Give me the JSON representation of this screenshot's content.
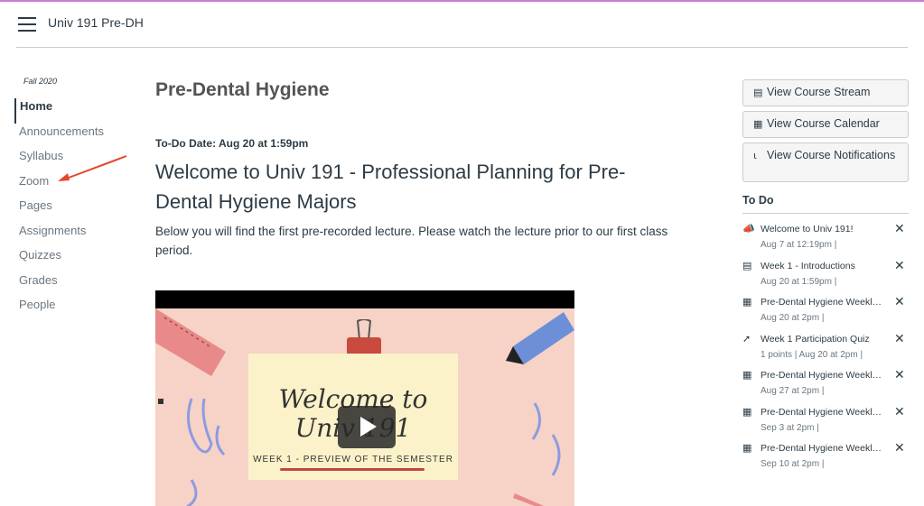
{
  "header": {
    "course_title": "Univ 191 Pre-DH"
  },
  "nav": {
    "term": "Fall 2020",
    "items": [
      {
        "label": "Home"
      },
      {
        "label": "Announcements"
      },
      {
        "label": "Syllabus"
      },
      {
        "label": "Zoom"
      },
      {
        "label": "Pages"
      },
      {
        "label": "Assignments"
      },
      {
        "label": "Quizzes"
      },
      {
        "label": "Grades"
      },
      {
        "label": "People"
      }
    ]
  },
  "main": {
    "page_title": "Pre-Dental Hygiene",
    "todo_date": "To-Do Date: Aug 20 at 1:59pm",
    "welcome": "Welcome to Univ 191 - Professional Planning for Pre-Dental Hygiene Majors",
    "description": "Below you will find the first pre-recorded lecture. Please watch the lecture prior to our first class period.",
    "video": {
      "title": "Welcome to Univ 191",
      "subtitle": "WEEK 1 - PREVIEW OF THE SEMESTER"
    }
  },
  "sidebar": {
    "buttons": [
      {
        "label": "View Course Stream",
        "icon": "stream-icon"
      },
      {
        "label": "View Course Calendar",
        "icon": "calendar-icon"
      },
      {
        "label": "View Course Notifications",
        "icon": "bell-icon"
      }
    ],
    "todo_heading": "To Do",
    "todo": [
      {
        "title": "Welcome to Univ 191!",
        "meta": "Aug 7 at 12:19pm  |",
        "icon": "announcement-icon"
      },
      {
        "title": "Week 1 - Introductions",
        "meta": "Aug 20 at 1:59pm  |",
        "icon": "page-icon"
      },
      {
        "title": "Pre-Dental Hygiene Weekly Reflection",
        "meta": "Aug 20 at 2pm  |",
        "icon": "assignment-icon"
      },
      {
        "title": "Week 1 Participation Quiz",
        "meta": "1 points  |  Aug 20 at 2pm  |",
        "icon": "quiz-icon"
      },
      {
        "title": "Pre-Dental Hygiene Weekly Reflection",
        "meta": "Aug 27 at 2pm  |",
        "icon": "assignment-icon"
      },
      {
        "title": "Pre-Dental Hygiene Weekly Reflection",
        "meta": "Sep 3 at 2pm  |",
        "icon": "assignment-icon"
      },
      {
        "title": "Pre-Dental Hygiene Weekly Reflection",
        "meta": "Sep 10 at 2pm  |",
        "icon": "assignment-icon"
      }
    ]
  },
  "colors": {
    "accent": "#c97ed6",
    "arrow": "#e4472b",
    "text": "#2d3b45"
  }
}
